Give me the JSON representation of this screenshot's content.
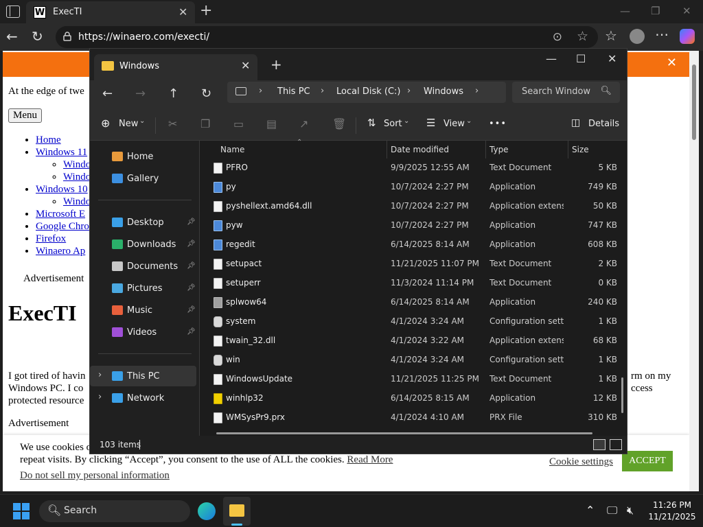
{
  "browser": {
    "tab_title": "ExecTI",
    "tab_favicon": "W",
    "url": "https://winaero.com/execti/",
    "icons": {
      "back": "arrow-left",
      "refresh": "refresh",
      "lock": "lock",
      "read_aloud": "read-aloud",
      "favorite": "star",
      "favorites": "favorites-list",
      "more": "ellipsis",
      "copilot": "copilot"
    }
  },
  "webpage": {
    "tagline": "At the edge of twe",
    "menu_label": "Menu",
    "nav": [
      {
        "label": "Home"
      },
      {
        "label": "Windows 11",
        "children": [
          "Windo",
          "Windo"
        ]
      },
      {
        "label": "Windows 10",
        "children": [
          "Windo"
        ]
      },
      {
        "label": "Microsoft E"
      },
      {
        "label": "Google Chro"
      },
      {
        "label": "Firefox"
      },
      {
        "label": "Winaero Ap"
      }
    ],
    "advertisement_1": "Advertisement",
    "heading": "ExecTI",
    "intro_left": [
      "I got tired of havin",
      "Windows PC. I co",
      "protected resource"
    ],
    "intro_right": [
      "rm on my",
      "ccess"
    ],
    "advertisement_2": "Advertisement",
    "cookie": {
      "line1": "We use cookies o",
      "line2": "repeat visits. By clicking “Accept”, you consent to the use of ALL the cookies.",
      "read_more": "Read More",
      "do_not_sell": "Do not sell my personal information",
      "settings": "Cookie settings",
      "accept": "ACCEPT"
    }
  },
  "explorer": {
    "tab_title": "Windows",
    "breadcrumbs": [
      "This PC",
      "Local Disk (C:)",
      "Windows"
    ],
    "search_placeholder": "Search Windows",
    "commands": {
      "new": "New",
      "sort": "Sort",
      "view": "View",
      "more": "•••",
      "details": "Details"
    },
    "nav_items": [
      {
        "label": "Home",
        "color": "#e89a3c"
      },
      {
        "label": "Gallery",
        "color": "#3c8fe0"
      },
      {
        "label": "Desktop",
        "color": "#3aa0e8",
        "pinned": true
      },
      {
        "label": "Downloads",
        "color": "#2ab06a",
        "pinned": true
      },
      {
        "label": "Documents",
        "color": "#c8c8c8",
        "pinned": true
      },
      {
        "label": "Pictures",
        "color": "#4aa8e0",
        "pinned": true
      },
      {
        "label": "Music",
        "color": "#e8603c",
        "pinned": true
      },
      {
        "label": "Videos",
        "color": "#a050d8",
        "pinned": true
      },
      {
        "label": "This PC",
        "color": "#3aa0e8",
        "expandable": true
      },
      {
        "label": "Network",
        "color": "#3aa0e8",
        "expandable": true
      }
    ],
    "columns": {
      "name": "Name",
      "date": "Date modified",
      "type": "Type",
      "size": "Size"
    },
    "files": [
      {
        "name": "PFRO",
        "date": "9/9/2025 12:55 AM",
        "type": "Text Document",
        "size": "5 KB",
        "icon": "doc"
      },
      {
        "name": "py",
        "date": "10/7/2024 2:27 PM",
        "type": "Application",
        "size": "749 KB",
        "icon": "app"
      },
      {
        "name": "pyshellext.amd64.dll",
        "date": "10/7/2024 2:27 PM",
        "type": "Application extension",
        "size": "50 KB",
        "icon": "doc"
      },
      {
        "name": "pyw",
        "date": "10/7/2024 2:27 PM",
        "type": "Application",
        "size": "747 KB",
        "icon": "app"
      },
      {
        "name": "regedit",
        "date": "6/14/2025 8:14 AM",
        "type": "Application",
        "size": "608 KB",
        "icon": "app"
      },
      {
        "name": "setupact",
        "date": "11/21/2025 11:07 PM",
        "type": "Text Document",
        "size": "2 KB",
        "icon": "doc"
      },
      {
        "name": "setuperr",
        "date": "11/3/2024 11:14 PM",
        "type": "Text Document",
        "size": "0 KB",
        "icon": "doc"
      },
      {
        "name": "splwow64",
        "date": "6/14/2025 8:14 AM",
        "type": "Application",
        "size": "240 KB",
        "icon": "prt"
      },
      {
        "name": "system",
        "date": "4/1/2024 3:24 AM",
        "type": "Configuration settings",
        "size": "1 KB",
        "icon": "cfg"
      },
      {
        "name": "twain_32.dll",
        "date": "4/1/2024 3:22 AM",
        "type": "Application extension",
        "size": "68 KB",
        "icon": "doc"
      },
      {
        "name": "win",
        "date": "4/1/2024 3:24 AM",
        "type": "Configuration settings",
        "size": "1 KB",
        "icon": "cfg"
      },
      {
        "name": "WindowsUpdate",
        "date": "11/21/2025 11:25 PM",
        "type": "Text Document",
        "size": "1 KB",
        "icon": "doc"
      },
      {
        "name": "winhlp32",
        "date": "6/14/2025 8:15 AM",
        "type": "Application",
        "size": "12 KB",
        "icon": "help"
      },
      {
        "name": "WMSysPr9.prx",
        "date": "4/1/2024 4:10 AM",
        "type": "PRX File",
        "size": "310 KB",
        "icon": "doc"
      }
    ],
    "status": "103 items"
  },
  "taskbar": {
    "search_label": "Search",
    "time": "11:26 PM",
    "date": "11/21/2025"
  }
}
